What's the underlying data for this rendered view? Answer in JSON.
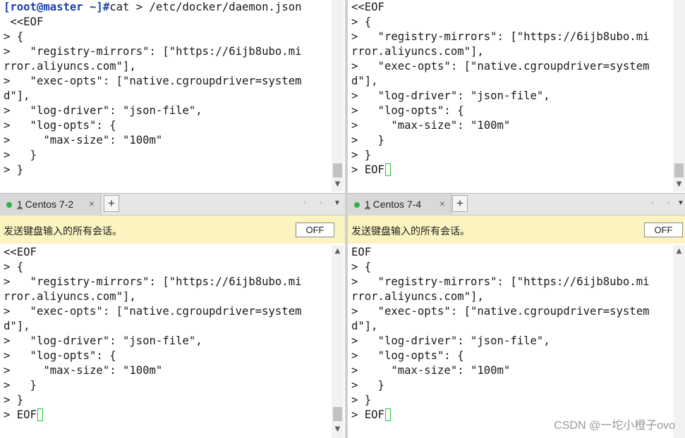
{
  "panes": {
    "top_left": {
      "lines": [
        [
          "[root@master ~]#",
          "cat > /etc/docker/daemon.json"
        ],
        [
          "",
          " <<EOF"
        ],
        [
          "",
          "> {"
        ],
        [
          "",
          ">   \"registry-mirrors\": [\"https://6ijb8ubo.mi"
        ],
        [
          "",
          "rror.aliyuncs.com\"],"
        ],
        [
          "",
          ">   \"exec-opts\": [\"native.cgroupdriver=system"
        ],
        [
          "",
          "d\"],"
        ],
        [
          "",
          ">   \"log-driver\": \"json-file\","
        ],
        [
          "",
          ">   \"log-opts\": {"
        ],
        [
          "",
          ">     \"max-size\": \"100m\""
        ],
        [
          "",
          ">   }"
        ],
        [
          "",
          "> }"
        ]
      ]
    },
    "top_right": {
      "lines": [
        "<<EOF",
        "> {",
        ">   \"registry-mirrors\": [\"https://6ijb8ubo.mi",
        "rror.aliyuncs.com\"],",
        ">   \"exec-opts\": [\"native.cgroupdriver=system",
        "d\"],",
        ">   \"log-driver\": \"json-file\",",
        ">   \"log-opts\": {",
        ">     \"max-size\": \"100m\"",
        ">   }",
        "> }"
      ],
      "last_line": "> EOF"
    },
    "bottom_left": {
      "tab": {
        "number": "1",
        "label": " Centos 7-2",
        "close": "×"
      },
      "lines": [
        "<<EOF",
        "> {",
        ">   \"registry-mirrors\": [\"https://6ijb8ubo.mi",
        "rror.aliyuncs.com\"],",
        ">   \"exec-opts\": [\"native.cgroupdriver=system",
        "d\"],",
        ">   \"log-driver\": \"json-file\",",
        ">   \"log-opts\": {",
        ">     \"max-size\": \"100m\"",
        ">   }",
        "> }"
      ],
      "last_line": "> EOF"
    },
    "bottom_right": {
      "tab": {
        "number": "1",
        "label": " Centos 7-4",
        "close": "×"
      },
      "lines": [
        "EOF",
        "> {",
        ">   \"registry-mirrors\": [\"https://6ijb8ubo.mi",
        "rror.aliyuncs.com\"],",
        ">   \"exec-opts\": [\"native.cgroupdriver=system",
        "d\"],",
        ">   \"log-driver\": \"json-file\",",
        ">   \"log-opts\": {",
        ">     \"max-size\": \"100m\"",
        ">   }",
        "> }"
      ],
      "last_line": "> EOF"
    }
  },
  "broadcast_bar": {
    "message": "发送键盘输入的所有会话。",
    "off_label": "OFF"
  },
  "tabbar": {
    "add_label": "+",
    "nav": "‹ ›",
    "dropdown": "▼"
  },
  "scroll": {
    "up": "▲",
    "down": "▼"
  },
  "watermark": "CSDN @一坨小橙子ovo",
  "colors": {
    "prompt": "#1c3fa8",
    "cursor": "#22c33a",
    "status_dot": "#2bb24c",
    "broadcast_bg": "#fbf3c0"
  }
}
